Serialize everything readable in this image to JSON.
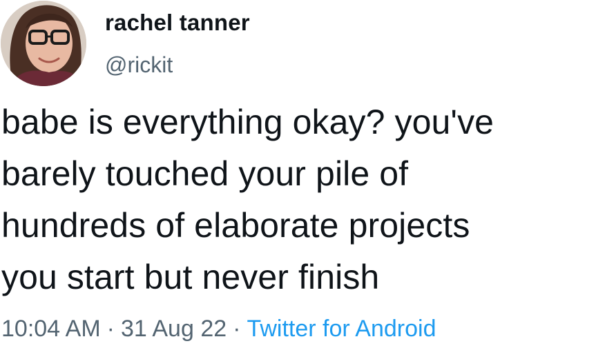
{
  "tweet": {
    "display_name": "rachel tanner",
    "handle": "@rickit",
    "text": "babe is everything okay? you've\nbarely touched your pile of\nhundreds of elaborate projects\nyou start but never finish",
    "time": "10:04 AM",
    "separator": "·",
    "date": "31 Aug 22",
    "source": "Twitter for Android"
  },
  "colors": {
    "text": "#0f1419",
    "muted": "#536471",
    "link": "#1d9bf0"
  }
}
